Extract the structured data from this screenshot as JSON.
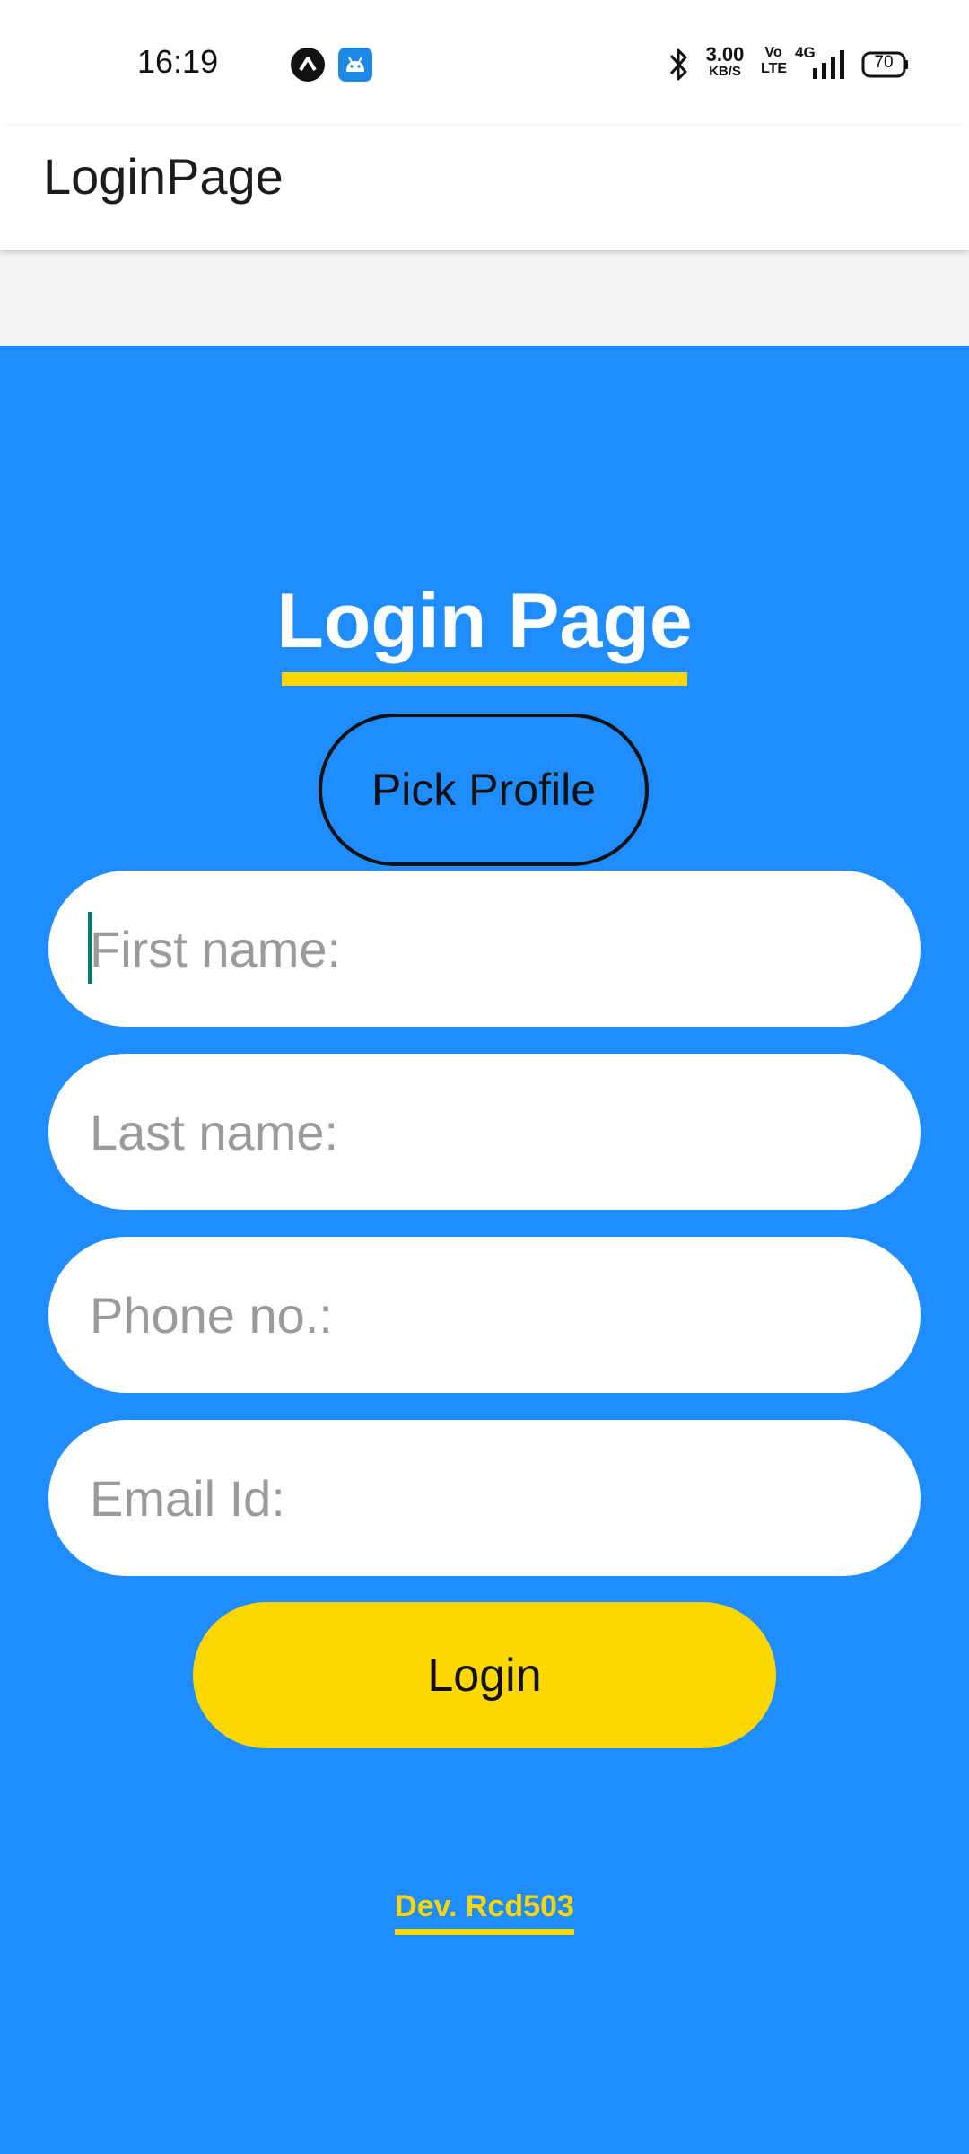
{
  "status_bar": {
    "time": "16:19",
    "speed_value": "3.00",
    "speed_unit": "KB/S",
    "volte_top": "Vo",
    "volte_bottom": "LTE",
    "network_type": "4G",
    "battery_level": "70",
    "icons": [
      "caret-up-badge-icon",
      "android-icon",
      "bluetooth-icon",
      "signal-icon",
      "battery-icon"
    ]
  },
  "app_bar": {
    "title": "LoginPage"
  },
  "main": {
    "heading": "Login Page",
    "pick_profile_label": "Pick Profile",
    "fields": {
      "first_name_placeholder": "First name:",
      "last_name_placeholder": "Last name:",
      "phone_placeholder": "Phone no.:",
      "email_placeholder": "Email Id:"
    },
    "login_label": "Login",
    "dev_credit": "Dev. Rcd503"
  },
  "colors": {
    "background_blue": "#1f8cff",
    "accent_yellow": "#ffd700",
    "caret_teal": "#0a7a6a"
  }
}
